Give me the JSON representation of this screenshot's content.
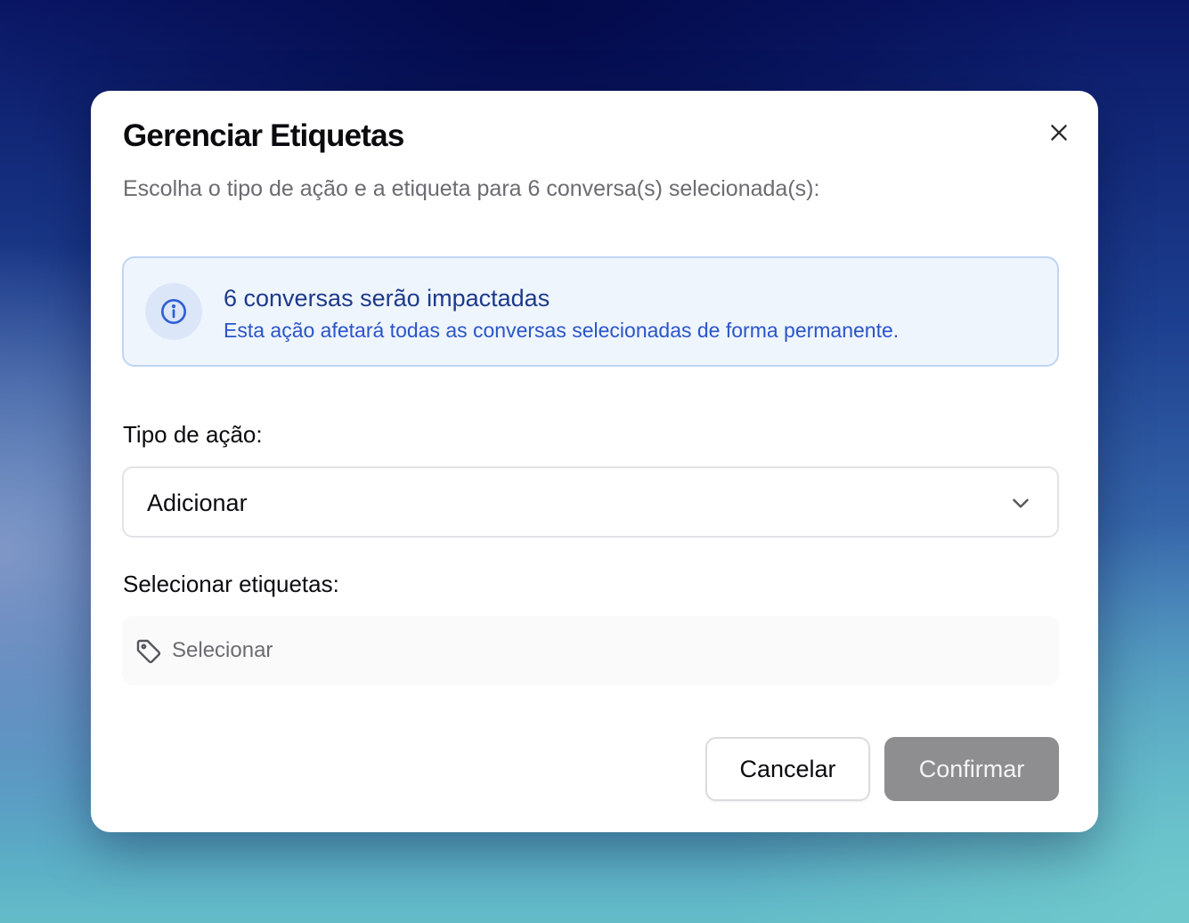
{
  "dialog": {
    "title": "Gerenciar Etiquetas",
    "subtitle": "Escolha o tipo de ação e a etiqueta para 6 conversa(s) selecionada(s):",
    "close_icon": "close-icon"
  },
  "info": {
    "icon": "info-icon",
    "title": "6 conversas serão impactadas",
    "description": "Esta ação afetará todas as conversas selecionadas de forma permanente."
  },
  "action_type": {
    "label": "Tipo de ação:",
    "selected_value": "Adicionar",
    "icon": "chevron-down-icon"
  },
  "tags": {
    "label": "Selecionar etiquetas:",
    "placeholder": "Selecionar",
    "icon": "tag-icon"
  },
  "buttons": {
    "cancel_label": "Cancelar",
    "confirm_label": "Confirmar"
  },
  "colors": {
    "info_background": "#eff5fd",
    "info_border": "#bfd5f2",
    "info_title": "#1d3a8a",
    "info_text": "#2a55c9",
    "confirm_disabled": "#8e8e90"
  }
}
